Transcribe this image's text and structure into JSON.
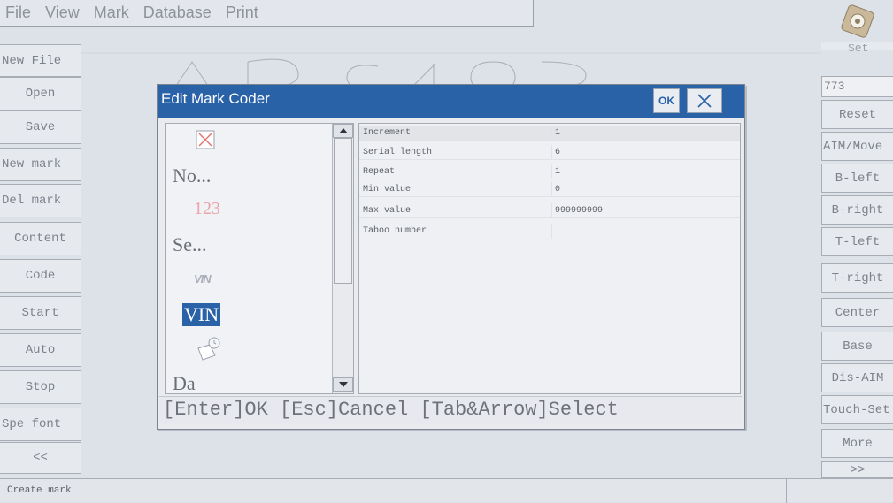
{
  "menu": [
    "File",
    "View",
    "Mark",
    "Database",
    "Print"
  ],
  "left_buttons": [
    "New File",
    "Open",
    "Save",
    "New mark",
    "Del mark",
    "Content",
    "Code",
    "Start",
    "Auto",
    "Stop",
    "Spe font",
    "<<"
  ],
  "right_panel": {
    "gear_icon": "gear-hand-icon",
    "top_label": "Set",
    "value_field": "773",
    "buttons": [
      "Reset",
      "AIM/Move",
      "B-left",
      "B-right",
      "T-left",
      "T-right",
      "Center",
      "Base",
      "Dis-AIM",
      "Touch-Set",
      "More",
      ">>"
    ]
  },
  "status": {
    "text": "Create mark"
  },
  "dialog": {
    "title": "Edit Mark Coder",
    "ok_label": "OK",
    "close_icon": "close-icon",
    "list_items": [
      {
        "kind": "icon",
        "icon": "broken-image-icon"
      },
      {
        "kind": "text",
        "label": "No..."
      },
      {
        "kind": "text",
        "label": "123",
        "color": "#e8a3ab"
      },
      {
        "kind": "text",
        "label": "Se..."
      },
      {
        "kind": "text",
        "label": "VIN",
        "style": "italic-faint"
      },
      {
        "kind": "text",
        "label": "VIN",
        "selected": true
      },
      {
        "kind": "icon",
        "icon": "clock-folder-icon"
      },
      {
        "kind": "text",
        "label": "Da"
      }
    ],
    "properties": [
      {
        "name": "Increment",
        "value": "1",
        "selected": true
      },
      {
        "name": "Serial length",
        "value": "6"
      },
      {
        "name": "Repeat",
        "value": "1"
      },
      {
        "name": "Min value",
        "value": "0"
      },
      {
        "name": "Max value",
        "value": "999999999"
      },
      {
        "name": "Taboo number",
        "value": ""
      }
    ],
    "hint": "[Enter]OK [Esc]Cancel [Tab&Arrow]Select"
  },
  "colors": {
    "title_bar": "#2a62a8",
    "selected_item": "#2a62a8",
    "background": "#dde1e8"
  }
}
